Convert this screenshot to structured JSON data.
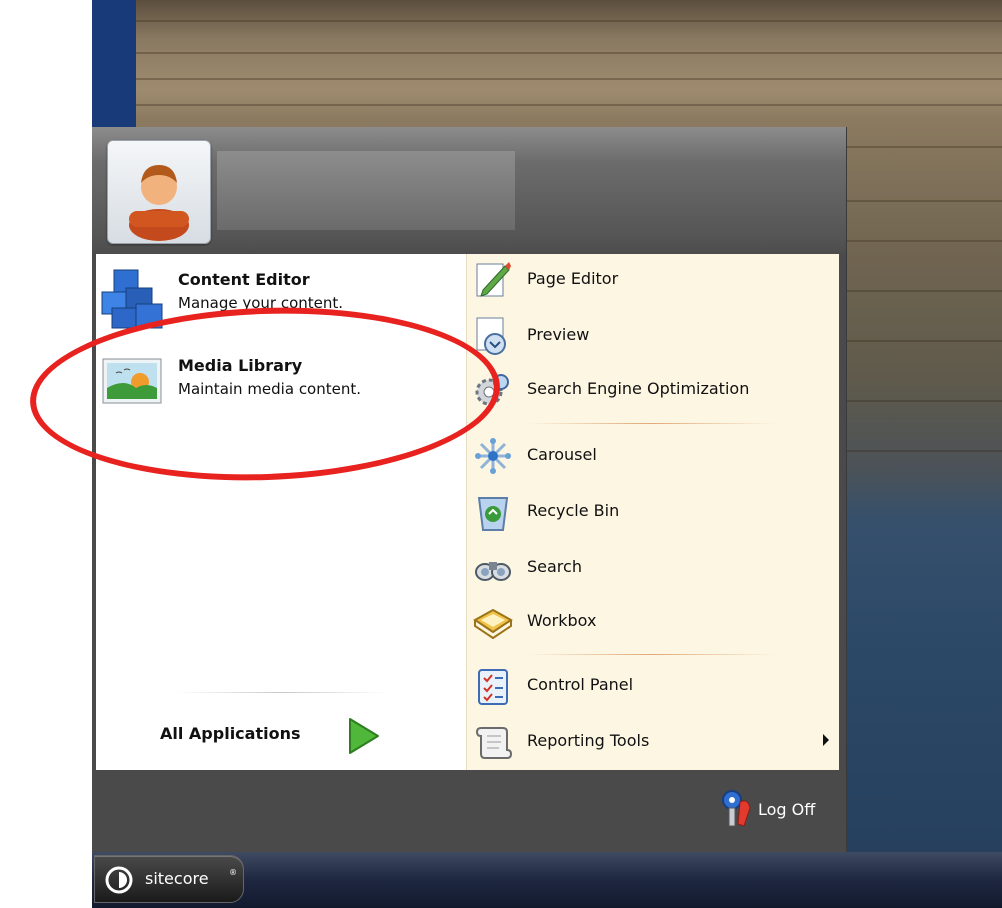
{
  "user": {
    "avatar_icon": "user-avatar-icon"
  },
  "left_apps": [
    {
      "title": "Content Editor",
      "description": "Manage your content.",
      "icon": "cubes-icon"
    },
    {
      "title": "Media Library",
      "description": "Maintain media content.",
      "icon": "picture-icon"
    }
  ],
  "all_applications": {
    "label": "All Applications",
    "icon": "green-arrow-icon"
  },
  "right_items": [
    {
      "label": "Page Editor",
      "icon": "page-editor-icon"
    },
    {
      "label": "Preview",
      "icon": "preview-icon"
    },
    {
      "label": "Search Engine Optimization",
      "icon": "seo-gear-icon"
    },
    {
      "label": "Carousel",
      "icon": "carousel-icon"
    },
    {
      "label": "Recycle Bin",
      "icon": "recycle-bin-icon"
    },
    {
      "label": "Search",
      "icon": "binoculars-icon"
    },
    {
      "label": "Workbox",
      "icon": "workbox-icon"
    },
    {
      "label": "Control Panel",
      "icon": "control-panel-icon"
    },
    {
      "label": "Reporting Tools",
      "icon": "scroll-icon",
      "has_submenu": true
    }
  ],
  "footer": {
    "logoff_label": "Log Off",
    "logoff_icon": "keys-icon"
  },
  "taskbar": {
    "start_label": "sitecore",
    "start_sup": "®"
  },
  "colors": {
    "annotation": "#e8221e",
    "right_panel_bg": "#fdf6e3",
    "taskbar": "#1e2740"
  }
}
